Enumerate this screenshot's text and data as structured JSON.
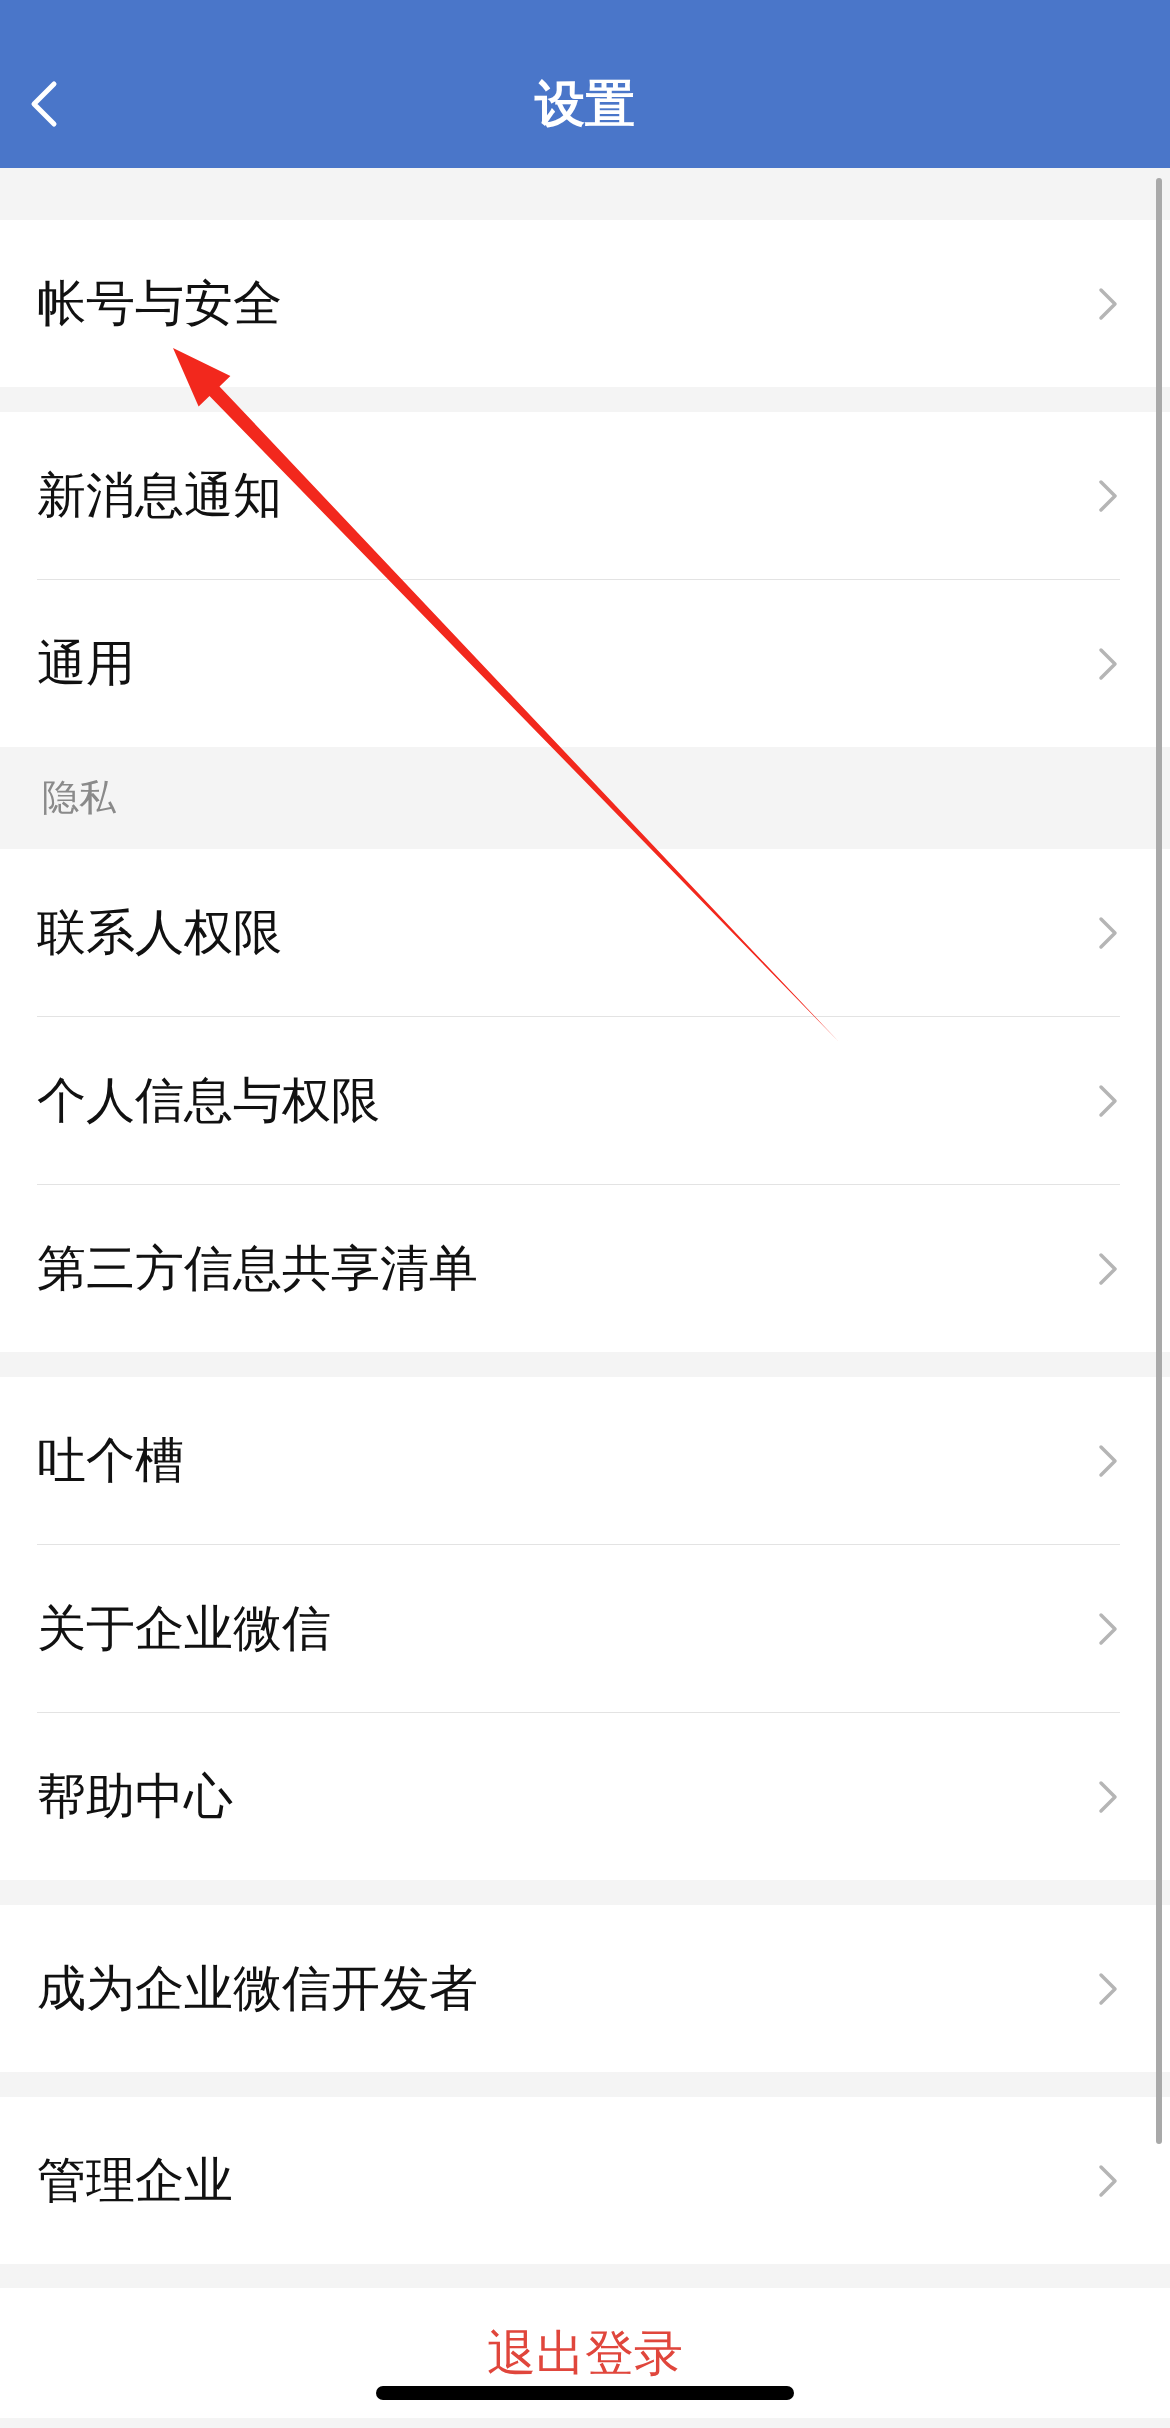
{
  "header": {
    "title": "设置"
  },
  "sections": [
    {
      "items": [
        {
          "label": "帐号与安全"
        }
      ]
    },
    {
      "items": [
        {
          "label": "新消息通知"
        },
        {
          "label": "通用"
        }
      ]
    },
    {
      "title": "隐私",
      "items": [
        {
          "label": "联系人权限"
        },
        {
          "label": "个人信息与权限"
        },
        {
          "label": "第三方信息共享清单"
        }
      ]
    },
    {
      "items": [
        {
          "label": "吐个槽"
        },
        {
          "label": "关于企业微信"
        },
        {
          "label": "帮助中心"
        }
      ]
    },
    {
      "items": [
        {
          "label": "成为企业微信开发者"
        }
      ]
    },
    {
      "items": [
        {
          "label": "管理企业"
        }
      ]
    }
  ],
  "logout": "退出登录",
  "annotations": [
    {
      "kind": "arrow"
    }
  ]
}
